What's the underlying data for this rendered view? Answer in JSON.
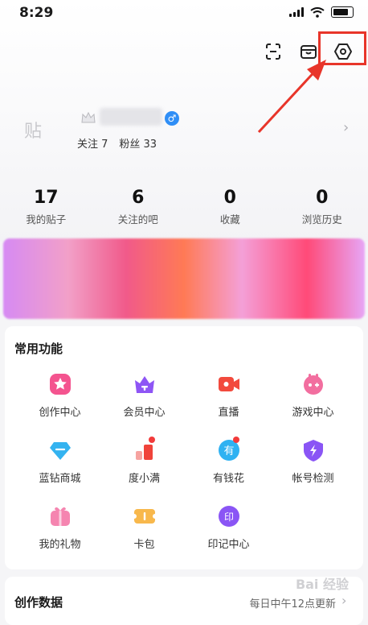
{
  "status_bar": {
    "time": "8:29"
  },
  "profile": {
    "avatar_text": "贴",
    "follow_label": "关注 7",
    "fans_label": "粉丝 33"
  },
  "stats": [
    {
      "value": "17",
      "label": "我的贴子"
    },
    {
      "value": "6",
      "label": "关注的吧"
    },
    {
      "value": "0",
      "label": "收藏"
    },
    {
      "value": "0",
      "label": "浏览历史"
    }
  ],
  "common_functions": {
    "title": "常用功能",
    "items": [
      {
        "label": "创作中心",
        "icon": "star-icon",
        "color": "#f4548f"
      },
      {
        "label": "会员中心",
        "icon": "crown-icon",
        "color": "#8e55f5"
      },
      {
        "label": "直播",
        "icon": "video-icon",
        "color": "#f24a3d"
      },
      {
        "label": "游戏中心",
        "icon": "gamepad-icon",
        "color": "#f26e9f"
      },
      {
        "label": "蓝钻商城",
        "icon": "diamond-icon",
        "color": "#34b3f0"
      },
      {
        "label": "度小满",
        "icon": "chart-icon",
        "color": "#f0433a",
        "badge": true
      },
      {
        "label": "有钱花",
        "icon": "money-icon",
        "color": "#2fb2f2",
        "badge": true
      },
      {
        "label": "帐号检测",
        "icon": "shield-icon",
        "color": "#8a55f5"
      },
      {
        "label": "我的礼物",
        "icon": "gift-icon",
        "color": "#f585b0"
      },
      {
        "label": "卡包",
        "icon": "ticket-icon",
        "color": "#f8b84c"
      },
      {
        "label": "印记中心",
        "icon": "seal-icon",
        "color": "#8a55f5"
      }
    ]
  },
  "creation_data": {
    "title": "创作数据",
    "update_note": "每日中午12点更新"
  },
  "watermark": "Bai 经验",
  "colors": {
    "highlight": "#e8352a",
    "gender": "#2f8ef6"
  }
}
